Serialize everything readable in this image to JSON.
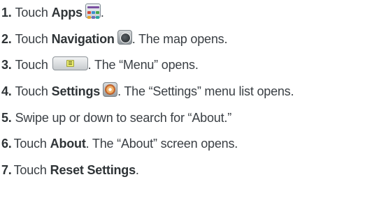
{
  "steps": [
    {
      "number": "1.",
      "pre": "Touch",
      "bold": "Apps",
      "icon": "apps-grid-icon",
      "post": "."
    },
    {
      "number": "2.",
      "pre": "Touch",
      "bold": "Navigation",
      "icon": "navigation-globe-icon",
      "post": ". The map opens."
    },
    {
      "number": "3.",
      "pre": "Touch",
      "bold": "",
      "icon": "menu-button-icon",
      "post": ". The “Menu” opens."
    },
    {
      "number": "4.",
      "pre": "Touch",
      "bold": "Settings",
      "icon": "settings-icon",
      "post": ". The “Settings” menu list opens."
    },
    {
      "number": "5.",
      "pre": "Swipe up or down to search for “About.”",
      "bold": "",
      "post": ""
    },
    {
      "number": "6.",
      "pre": "Touch",
      "bold": "About",
      "post": ". The “About” screen opens."
    },
    {
      "number": "7.",
      "pre": "Touch",
      "bold": "Reset Settings",
      "post": "."
    }
  ],
  "colors": {
    "text": "#3a3f44",
    "apps_top_bar": "#7a4fa0",
    "menu_icon_fill": "#e8ea6e",
    "settings_icon_ring": "#f0b26a"
  }
}
